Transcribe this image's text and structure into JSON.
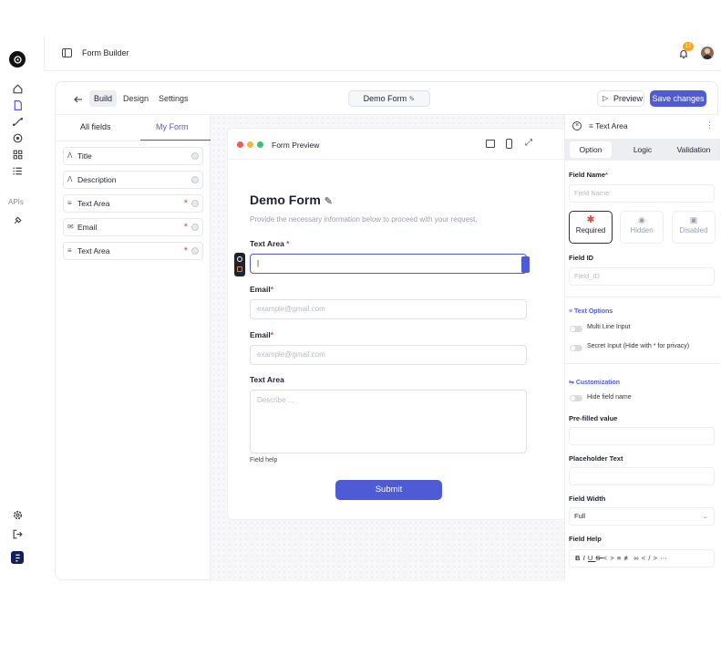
{
  "app": {
    "title": "Form Builder",
    "notification_count": "12"
  },
  "rail": {
    "apis_label": "APIs"
  },
  "toolbar": {
    "tabs": [
      "Build",
      "Design",
      "Settings"
    ],
    "form_name": "Demo Form",
    "preview_label": "Preview",
    "save_label": "Save changes"
  },
  "fields_panel": {
    "tabs": [
      "All fields",
      "My Form"
    ],
    "items": [
      {
        "label": "Title",
        "required": false,
        "icon": "text-icon"
      },
      {
        "label": "Description",
        "required": false,
        "icon": "text-icon"
      },
      {
        "label": "Text Area",
        "required": true,
        "icon": "lines-icon"
      },
      {
        "label": "Email",
        "required": true,
        "icon": "mail-icon"
      },
      {
        "label": "Text Area",
        "required": true,
        "icon": "lines-icon"
      }
    ],
    "required_mark": "*"
  },
  "preview": {
    "window_title": "Form Preview",
    "form_title": "Demo Form",
    "form_desc": "Provide the necessary information below to proceed with your request.",
    "fields": [
      {
        "label": "Text Area",
        "required_mark": " *",
        "placeholder": ""
      },
      {
        "label": "Email",
        "required_mark": "*",
        "placeholder": "example@gmail.com"
      },
      {
        "label": "Email",
        "required_mark": "*",
        "placeholder": "example@gmail.com"
      },
      {
        "label": "Text Area",
        "required_mark": "",
        "placeholder": "Describe ..."
      }
    ],
    "field_help": "Field help",
    "submit_label": "Submit"
  },
  "settings_panel": {
    "title": "Text Area",
    "tabs": [
      "Option",
      "Logic",
      "Validation"
    ],
    "active_tab": "Option",
    "field_name_label": "Field Name",
    "field_name_placeholder": "Field Name",
    "option_cards": [
      "Required",
      "Hidden",
      "Disabled"
    ],
    "field_id_label": "Field ID",
    "field_id_placeholder": "Field_ID",
    "text_options_title": "Text Options",
    "multi_line": "Multi Line Input",
    "secret_input": "Secret Input (Hide with * for privacy)",
    "customization_title": "Customization",
    "hide_field_name": "Hide field name",
    "prefilled_label": "Pre-filled value",
    "placeholder_label": "Placeholder Text",
    "field_width_label": "Field Width",
    "field_width_value": "Full",
    "field_help_label": "Field Help"
  },
  "colors": {
    "accent": "#4f5bd5",
    "required": "#e04848"
  }
}
